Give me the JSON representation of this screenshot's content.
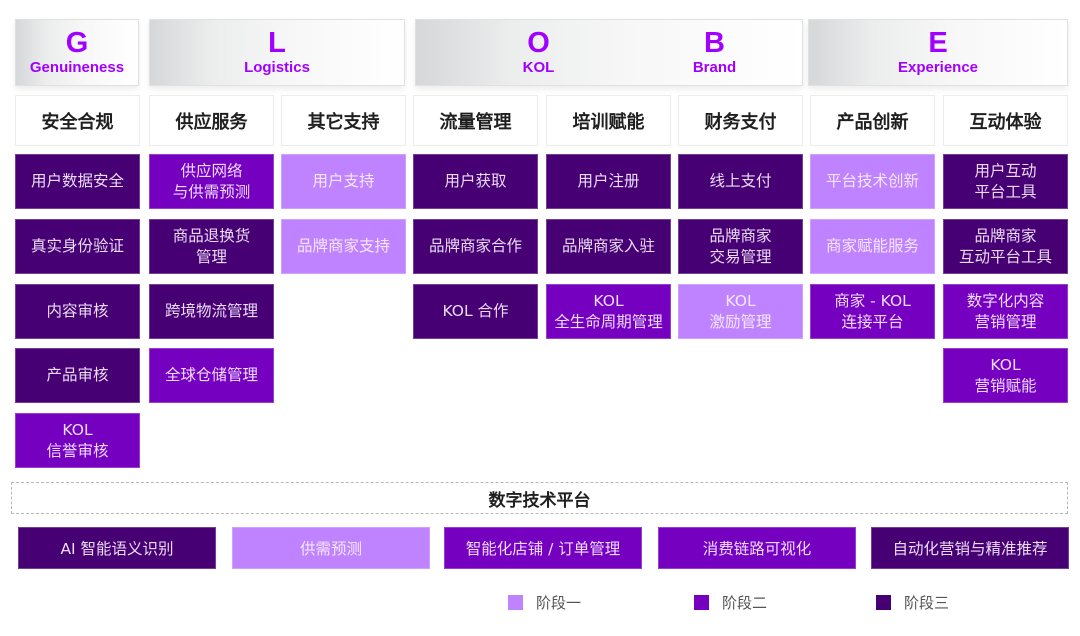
{
  "pillars": [
    {
      "letter": "G",
      "word": "Genuineness"
    },
    {
      "letter": "L",
      "word": "Logistics"
    },
    {
      "letter": "O",
      "word": "KOL"
    },
    {
      "letter": "B",
      "word": "Brand"
    },
    {
      "letter": "E",
      "word": "Experience"
    }
  ],
  "categories": [
    "安全合规",
    "供应服务",
    "其它支持",
    "流量管理",
    "培训赋能",
    "财务支付",
    "产品创新",
    "互动体验"
  ],
  "columns": [
    {
      "category": "安全合规",
      "cells": [
        {
          "lines": [
            "用户数据安全"
          ],
          "stage": 3
        },
        {
          "lines": [
            "真实身份验证"
          ],
          "stage": 3
        },
        {
          "lines": [
            "内容审核"
          ],
          "stage": 3
        },
        {
          "lines": [
            "产品审核"
          ],
          "stage": 3
        },
        {
          "lines": [
            "KOL",
            "信誉审核"
          ],
          "stage": 2
        }
      ]
    },
    {
      "category": "供应服务",
      "cells": [
        {
          "lines": [
            "供应网络",
            "与供需预测"
          ],
          "stage": 2
        },
        {
          "lines": [
            "商品退换货",
            "管理"
          ],
          "stage": 3
        },
        {
          "lines": [
            "跨境物流管理"
          ],
          "stage": 3
        },
        {
          "lines": [
            "全球仓储管理"
          ],
          "stage": 2
        }
      ]
    },
    {
      "category": "其它支持",
      "cells": [
        {
          "lines": [
            "用户支持"
          ],
          "stage": 1
        },
        {
          "lines": [
            "品牌商家支持"
          ],
          "stage": 1
        }
      ]
    },
    {
      "category": "流量管理",
      "cells": [
        {
          "lines": [
            "用户获取"
          ],
          "stage": 3
        },
        {
          "lines": [
            "品牌商家合作"
          ],
          "stage": 3
        },
        {
          "lines": [
            "KOL 合作"
          ],
          "stage": 3
        }
      ]
    },
    {
      "category": "培训赋能",
      "cells": [
        {
          "lines": [
            "用户注册"
          ],
          "stage": 3
        },
        {
          "lines": [
            "品牌商家入驻"
          ],
          "stage": 3
        },
        {
          "lines": [
            "KOL",
            "全生命周期管理"
          ],
          "stage": 2
        }
      ]
    },
    {
      "category": "财务支付",
      "cells": [
        {
          "lines": [
            "线上支付"
          ],
          "stage": 3
        },
        {
          "lines": [
            "品牌商家",
            "交易管理"
          ],
          "stage": 3
        },
        {
          "lines": [
            "KOL",
            "激励管理"
          ],
          "stage": 1
        }
      ]
    },
    {
      "category": "产品创新",
      "cells": [
        {
          "lines": [
            "平台技术创新"
          ],
          "stage": 1
        },
        {
          "lines": [
            "商家赋能服务"
          ],
          "stage": 1
        },
        {
          "lines": [
            "商家 - KOL",
            "连接平台"
          ],
          "stage": 2
        }
      ]
    },
    {
      "category": "互动体验",
      "cells": [
        {
          "lines": [
            "用户互动",
            "平台工具"
          ],
          "stage": 3
        },
        {
          "lines": [
            "品牌商家",
            "互动平台工具"
          ],
          "stage": 3
        },
        {
          "lines": [
            "数字化内容",
            "营销管理"
          ],
          "stage": 2
        },
        {
          "lines": [
            "KOL",
            "营销赋能"
          ],
          "stage": 2
        }
      ]
    }
  ],
  "platform": {
    "title": "数字技术平台",
    "items": [
      {
        "label": "AI 智能语义识别",
        "stage": 3
      },
      {
        "label": "供需预测",
        "stage": 1
      },
      {
        "label": "智能化店铺 / 订单管理",
        "stage": 2
      },
      {
        "label": "消费链路可视化",
        "stage": 2
      },
      {
        "label": "自动化营销与精准推荐",
        "stage": 3
      }
    ]
  },
  "legend": [
    {
      "label": "阶段一",
      "stage": 1,
      "color": "#c083ff"
    },
    {
      "label": "阶段二",
      "stage": 2,
      "color": "#7500c0"
    },
    {
      "label": "阶段三",
      "stage": 3,
      "color": "#460073"
    }
  ],
  "colors": {
    "accent": "#a100ff",
    "stage1": "#c083ff",
    "stage2": "#7500c0",
    "stage3": "#460073"
  }
}
